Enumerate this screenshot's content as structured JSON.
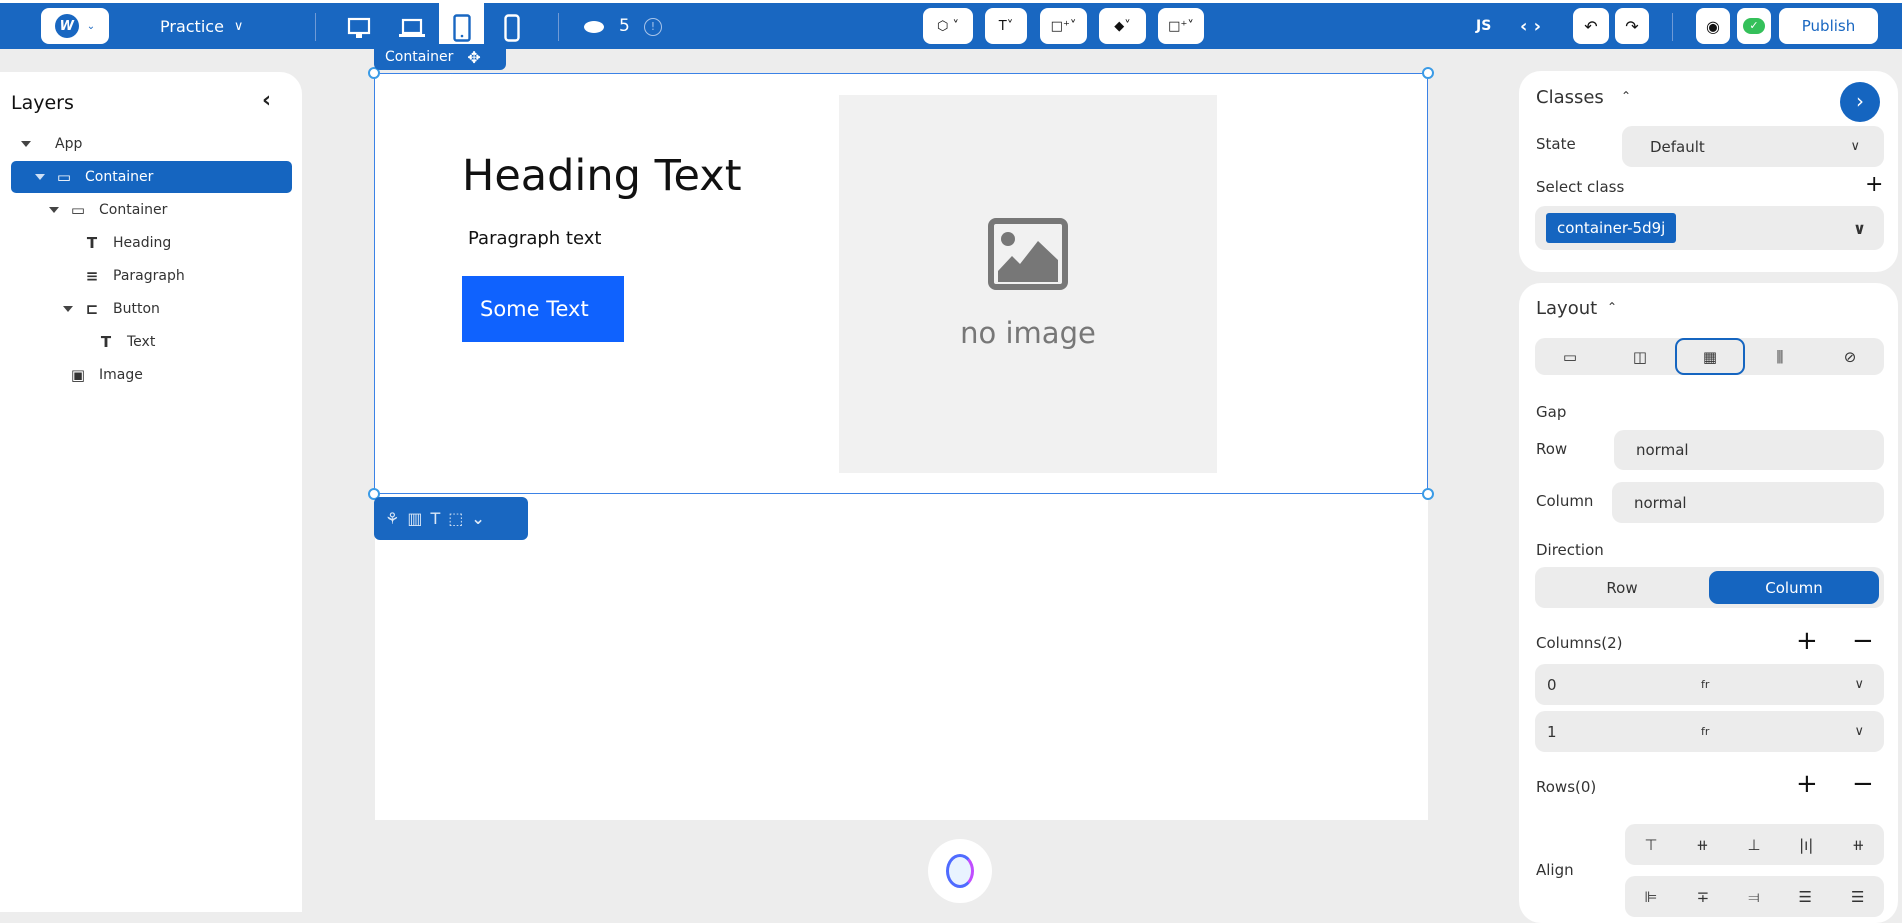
{
  "topbar": {
    "project_name": "Practice",
    "credits": "5",
    "js_label": "JS",
    "publish_label": "Publish",
    "devices": [
      "desktop-icon",
      "laptop-icon",
      "tablet-icon",
      "mobile-icon"
    ],
    "active_device": "tablet"
  },
  "selection": {
    "label": "Container"
  },
  "layers": {
    "title": "Layers",
    "items": [
      {
        "label": "App",
        "depth": 0,
        "icon": "none"
      },
      {
        "label": "Container",
        "depth": 1,
        "icon": "container",
        "selected": true
      },
      {
        "label": "Container",
        "depth": 2,
        "icon": "container"
      },
      {
        "label": "Heading",
        "depth": 3,
        "icon": "text"
      },
      {
        "label": "Paragraph",
        "depth": 3,
        "icon": "paragraph"
      },
      {
        "label": "Button",
        "depth": 3,
        "icon": "button"
      },
      {
        "label": "Text",
        "depth": 4,
        "icon": "text"
      },
      {
        "label": "Image",
        "depth": 2,
        "icon": "image"
      }
    ]
  },
  "canvas": {
    "heading": "Heading Text",
    "paragraph": "Paragraph text",
    "button": "Some Text",
    "image_placeholder": "no image",
    "button_color": "#0f62fe"
  },
  "classes": {
    "title": "Classes",
    "state_label": "State",
    "state_value": "Default",
    "select_class_label": "Select class",
    "class_chip": "container-5d9j"
  },
  "layout": {
    "title": "Layout",
    "display_options": [
      "block",
      "flex",
      "grid",
      "inline",
      "none"
    ],
    "active_display": "grid",
    "gap_label": "Gap",
    "row_label": "Row",
    "row_value": "normal",
    "column_label": "Column",
    "column_value": "normal",
    "direction_label": "Direction",
    "direction_options": [
      "Row",
      "Column"
    ],
    "direction_active": "Column",
    "columns_label": "Columns(2)",
    "columns": [
      {
        "value": "0",
        "unit": "fr"
      },
      {
        "value": "1",
        "unit": "fr"
      }
    ],
    "rows_label": "Rows(0)",
    "align_label": "Align"
  },
  "colors": {
    "brand": "#1967c1",
    "selected": "#1565c0"
  }
}
